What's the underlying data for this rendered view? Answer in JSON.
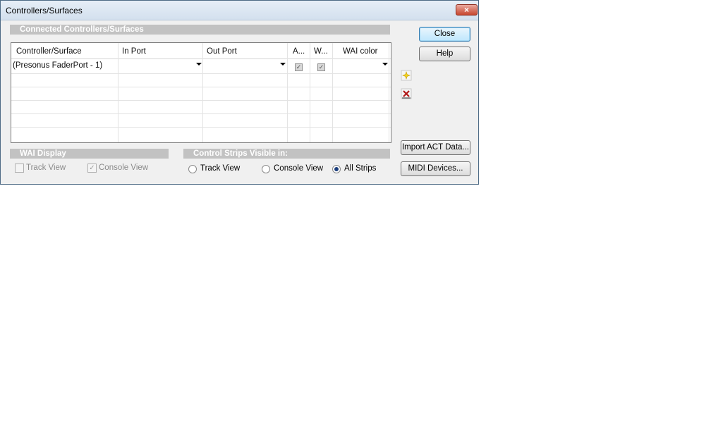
{
  "window": {
    "title": "Controllers/Surfaces",
    "close_glyph": "×"
  },
  "connected": {
    "section_title": "Connected Controllers/Surfaces",
    "columns": [
      "Controller/Surface",
      "In Port",
      "Out Port",
      "A...",
      "W...",
      "WAI color"
    ],
    "rows": [
      {
        "controller": "(Presonus FaderPort - 1)",
        "in_port": "",
        "out_port": "",
        "a_checked": true,
        "w_checked": true,
        "wai_color": ""
      }
    ]
  },
  "side_buttons": {
    "close": "Close",
    "help": "Help",
    "import": "Import ACT Data...",
    "midi": "MIDI Devices..."
  },
  "tool_icons": {
    "add": "add-controller-icon",
    "delete": "delete-controller-icon"
  },
  "wai_display": {
    "title": "WAI Display",
    "track_view": "Track View",
    "console_view": "Console View",
    "track_checked": false,
    "console_checked": true
  },
  "control_strips": {
    "title": "Control Strips Visible in:",
    "options": [
      "Track View",
      "Console View",
      "All Strips"
    ],
    "selected": "All Strips"
  }
}
